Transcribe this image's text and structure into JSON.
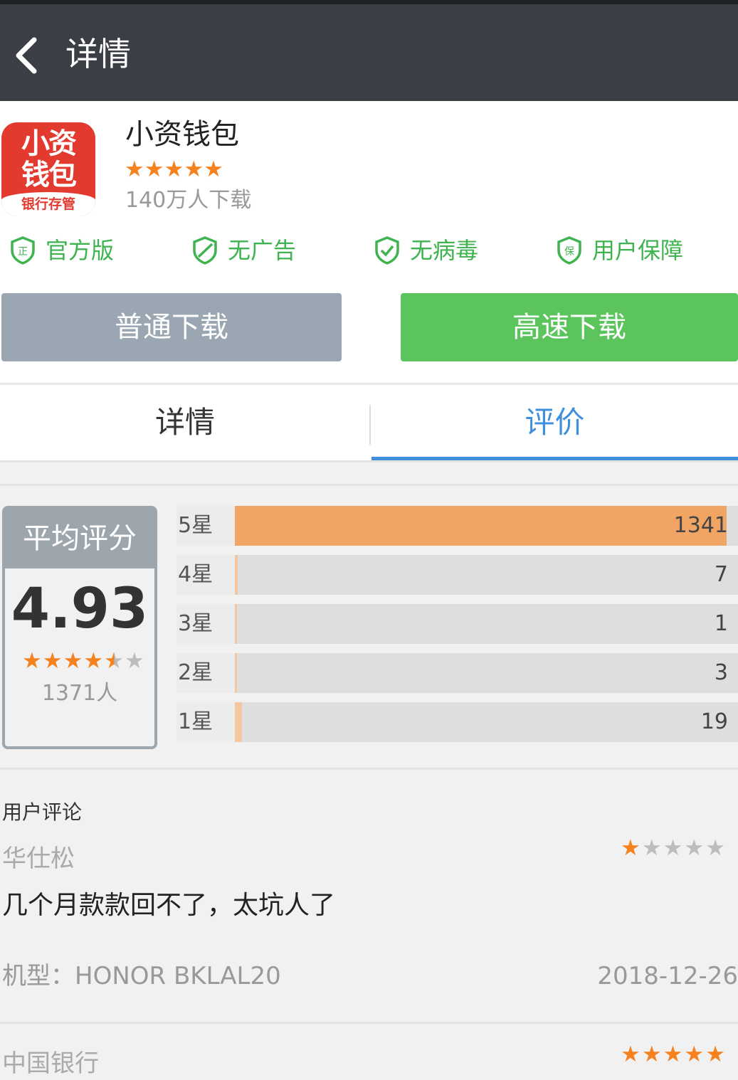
{
  "header": {
    "title": "详情",
    "back_icon": "chevron-left-icon"
  },
  "app": {
    "name": "小资钱包",
    "icon_text_line1": "小资",
    "icon_text_line2": "钱包",
    "icon_subtitle": "银行存管",
    "stars": "★★★★★",
    "downloads": "140万人下载"
  },
  "badges": [
    {
      "label": "官方版",
      "icon": "shield-official-icon"
    },
    {
      "label": "无广告",
      "icon": "shield-no-ads-icon"
    },
    {
      "label": "无病毒",
      "icon": "shield-no-virus-icon"
    },
    {
      "label": "用户保障",
      "icon": "shield-protection-icon"
    }
  ],
  "buttons": {
    "normal_download": "普通下载",
    "fast_download": "高速下载"
  },
  "tabs": [
    {
      "label": "详情",
      "active": false
    },
    {
      "label": "评价",
      "active": true
    }
  ],
  "rating": {
    "title": "平均评分",
    "score": "4.93",
    "count": "1371人",
    "stars_filled": 4.5,
    "distribution": [
      {
        "label": "5星",
        "value": "1341",
        "fraction": 0.978
      },
      {
        "label": "4星",
        "value": "7",
        "fraction": 0.005
      },
      {
        "label": "3星",
        "value": "1",
        "fraction": 0.001
      },
      {
        "label": "2星",
        "value": "3",
        "fraction": 0.002
      },
      {
        "label": "1星",
        "value": "19",
        "fraction": 0.014
      }
    ]
  },
  "comments": {
    "title": "用户评论",
    "items": [
      {
        "user": "华仕松",
        "stars": 1,
        "text": "几个月款款回不了，太坑人了",
        "device": "机型：HONOR BKLAL20",
        "date": "2018-12-26"
      },
      {
        "user": "中国银行",
        "stars": 5
      }
    ]
  },
  "colors": {
    "header_bg": "#3b3e45",
    "accent_blue": "#3f8fdc",
    "green": "#5cc45d",
    "gray_button": "#9aa7b2",
    "star_orange": "#f5821f",
    "bar_orange": "#f0a565"
  }
}
